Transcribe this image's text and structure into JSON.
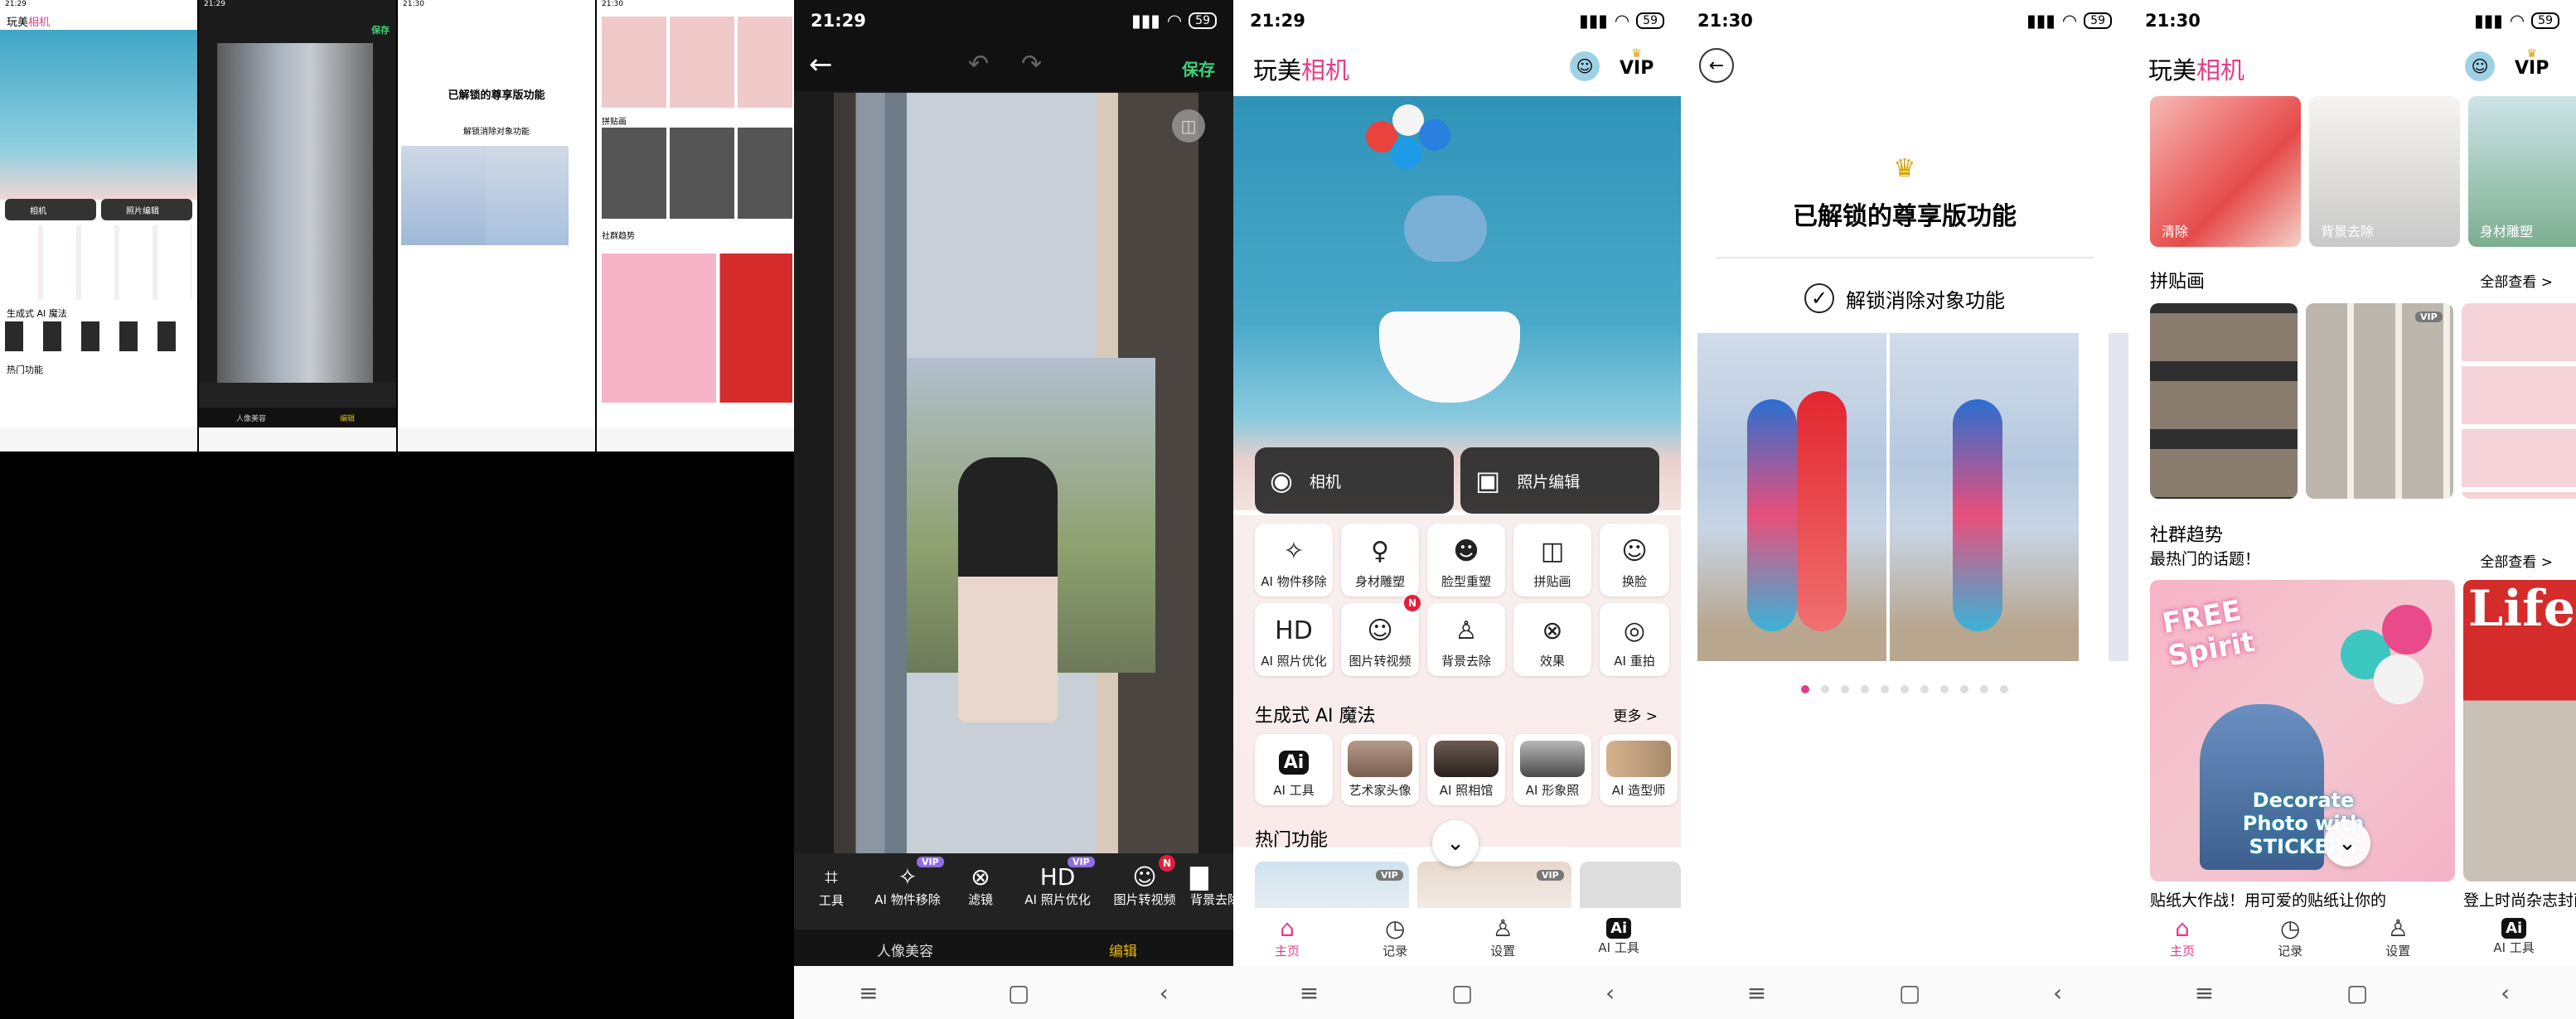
{
  "colors": {
    "accent": "#e33d8a",
    "vip": "#8e6de6",
    "save": "#3fd179",
    "gold": "#d8a000"
  },
  "status": {
    "t1": "21:29",
    "t2": "21:29",
    "t3": "21:30",
    "t4": "21:30",
    "battery": "59"
  },
  "home": {
    "logo_a": "玩美",
    "logo_b": "相机",
    "vip": "VIP",
    "camera": "相机",
    "photo_edit": "照片编辑",
    "tools": [
      "AI 物件移除",
      "身材雕塑",
      "脸型重塑",
      "拼贴画",
      "换脸",
      "AI 照片优化",
      "图片转视频",
      "背景去除",
      "效果",
      "AI 重拍"
    ],
    "badge_n": "N",
    "ai_title": "生成式 AI 魔法",
    "more": "更多 >",
    "ai_items": [
      "AI 工具",
      "艺术家头像",
      "AI 照相馆",
      "AI 形象照",
      "AI 造型师"
    ],
    "ai_icon": "Ai",
    "hot": "热门功能",
    "hot_vip": "VIP",
    "tabs": [
      "主页",
      "记录",
      "设置",
      "AI 工具"
    ]
  },
  "editor": {
    "save": "保存",
    "tools": [
      "工具",
      "AI 物件移除",
      "滤镜",
      "AI 照片优化",
      "图片转视频",
      "背景去除"
    ],
    "vip": "VIP",
    "badge_n": "N",
    "bottom_left": "人像美容",
    "bottom_right": "编辑"
  },
  "premium": {
    "title": "已解锁的尊享版功能",
    "feature": "解锁消除对象功能"
  },
  "feed": {
    "tile_labels": [
      "清除",
      "背景去除",
      "身材雕塑"
    ],
    "collage_title": "拼贴画",
    "see_all": "全部查看 >",
    "collage_vip": "VIP",
    "social_title": "社群趋势",
    "social_sub": "最热门的话题！",
    "sticker_a": "FREE",
    "sticker_b": "Spirit",
    "sticker_text": "Decorate Photo with STICKERS",
    "mag_title": "Life",
    "caption_left": "贴纸大作战！用可爱的贴纸让你的",
    "caption_right": "登上时尚杂志封面"
  }
}
